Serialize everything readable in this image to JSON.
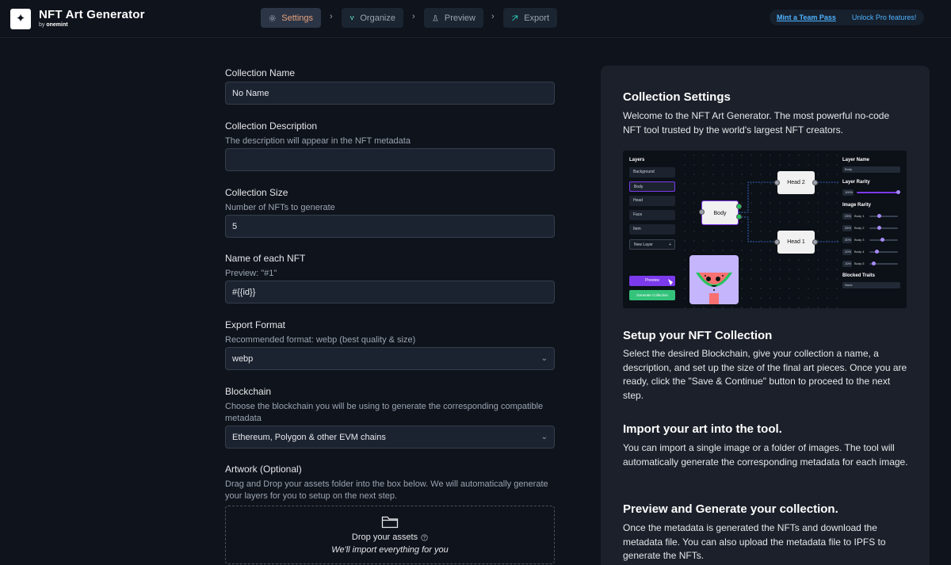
{
  "header": {
    "logo_glyph": "✦",
    "app_title": "NFT Art Generator",
    "byline_prefix": "by",
    "byline_brand": "onemint",
    "steps": [
      {
        "label": "Settings",
        "icon": "gear-icon"
      },
      {
        "label": "Organize",
        "icon": "cluster-icon"
      },
      {
        "label": "Preview",
        "icon": "flask-icon"
      },
      {
        "label": "Export",
        "icon": "export-icon"
      }
    ],
    "chevron": "›",
    "promo_link": "Mint a Team Pass",
    "promo_text": "Unlock Pro features!"
  },
  "form": {
    "collection_name": {
      "label": "Collection Name",
      "value": "No Name"
    },
    "collection_description": {
      "label": "Collection Description",
      "help": "The description will appear in the NFT metadata",
      "value": ""
    },
    "collection_size": {
      "label": "Collection Size",
      "help": "Number of NFTs to generate",
      "value": "5"
    },
    "nft_name": {
      "label": "Name of each NFT",
      "help": "Preview: \"#1\"",
      "value": "#{{id}}"
    },
    "export_format": {
      "label": "Export Format",
      "help": "Recommended format: webp (best quality & size)",
      "value": "webp"
    },
    "blockchain": {
      "label": "Blockchain",
      "help": "Choose the blockchain you will be using to generate the corresponding compatible metadata",
      "value": "Ethereum, Polygon & other EVM chains"
    },
    "artwork": {
      "label": "Artwork (Optional)",
      "help": "Drag and Drop your assets folder into the box below. We will automatically generate your layers for you to setup on the next step.",
      "drop_title": "Drop your assets",
      "drop_sub": "We'll import everything for you"
    }
  },
  "panel": {
    "settings_title": "Collection Settings",
    "settings_text": "Welcome to the NFT Art Generator. The most powerful no-code NFT tool trusted by the world's largest NFT creators.",
    "setup_title": "Setup your NFT Collection",
    "setup_text": "Select the desired Blockchain, give your collection a name, a description, and set up the size of the final art pieces. Once you are ready, click the \"Save & Continue\" button to proceed to the next step.",
    "import_title": "Import your art into the tool.",
    "import_text": "You can import a single image or a folder of images. The tool will automatically generate the corresponding metadata for each image.",
    "preview_title": "Preview and Generate your collection.",
    "preview_text": "Once the metadata is generated the NFTs and download the metadata file. You can also upload the metadata file to IPFS to generate the NFTs."
  },
  "demo": {
    "layers_title": "Layers",
    "layers": [
      "Background",
      "Body",
      "Head",
      "Face",
      "Item"
    ],
    "new_layer": "New Layer",
    "plus": "+",
    "nodes": {
      "body": "Body",
      "head2": "Head 2",
      "head1": "Head 1"
    },
    "preview_btn": "Preview",
    "generate_btn": "Generate Collection",
    "layer_name_title": "Layer Name",
    "layer_name_value": "Body",
    "layer_rarity_title": "Layer Rarity",
    "layer_rarity_value": "100%",
    "image_rarity_title": "Image Rarity",
    "image_rarity": [
      {
        "pct": "25%",
        "name": "Body 1"
      },
      {
        "pct": "25%",
        "name": "Body 2"
      },
      {
        "pct": "30%",
        "name": "Body 3"
      },
      {
        "pct": "20%",
        "name": "Body 4"
      },
      {
        "pct": "10%",
        "name": "Body 5"
      }
    ],
    "blocked_title": "Blocked Traits",
    "blocked_value": "None"
  },
  "colors": {
    "accent": "#e8a27c",
    "link": "#4fb3ff",
    "purple": "#7c3aed",
    "green": "#22c55e"
  }
}
